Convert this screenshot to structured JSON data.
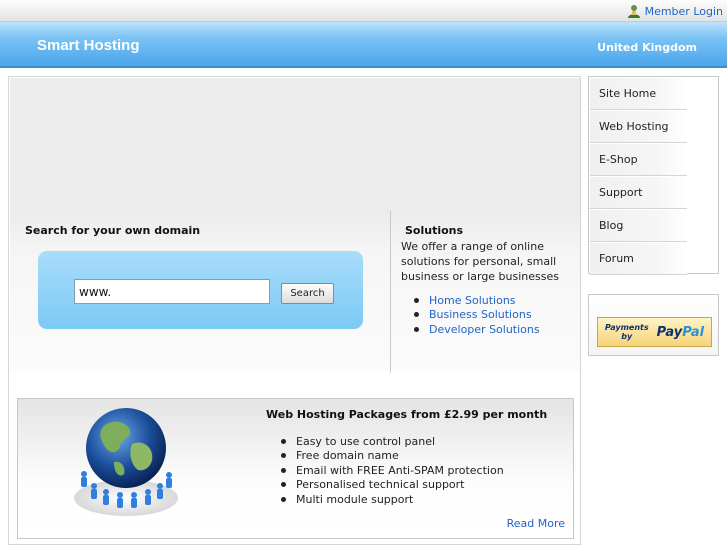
{
  "topbar": {
    "member_login": "Member Login"
  },
  "header": {
    "brand": "Smart Hosting",
    "region": "United Kingdom"
  },
  "search": {
    "title": "Search for your own domain",
    "input_value": "www.",
    "button": "Search"
  },
  "solutions": {
    "title": "Solutions",
    "description": "We offer a range of online solutions for personal, small business or large businesses",
    "links": [
      "Home Solutions",
      "Business Solutions",
      "Developer Solutions"
    ]
  },
  "packages": {
    "title": "Web Hosting Packages from £2.99 per month",
    "features": [
      "Easy to use control panel",
      "Free domain name",
      "Email with FREE Anti-SPAM protection",
      "Personalised technical support",
      "Multi module support"
    ],
    "read_more": "Read More"
  },
  "nav": {
    "items": [
      "Site Home",
      "Web Hosting",
      "E-Shop",
      "Support",
      "Blog",
      "Forum"
    ]
  },
  "payment": {
    "line1": "Payments",
    "line2": "by",
    "logo_pay": "Pay",
    "logo_pal": "Pal"
  },
  "icons": {
    "member": "member-login-icon",
    "globe": "globe-network-icon"
  },
  "colors": {
    "accent": "#4aa6ec",
    "link": "#1f64c8",
    "search_panel": "#7ccaf6"
  }
}
